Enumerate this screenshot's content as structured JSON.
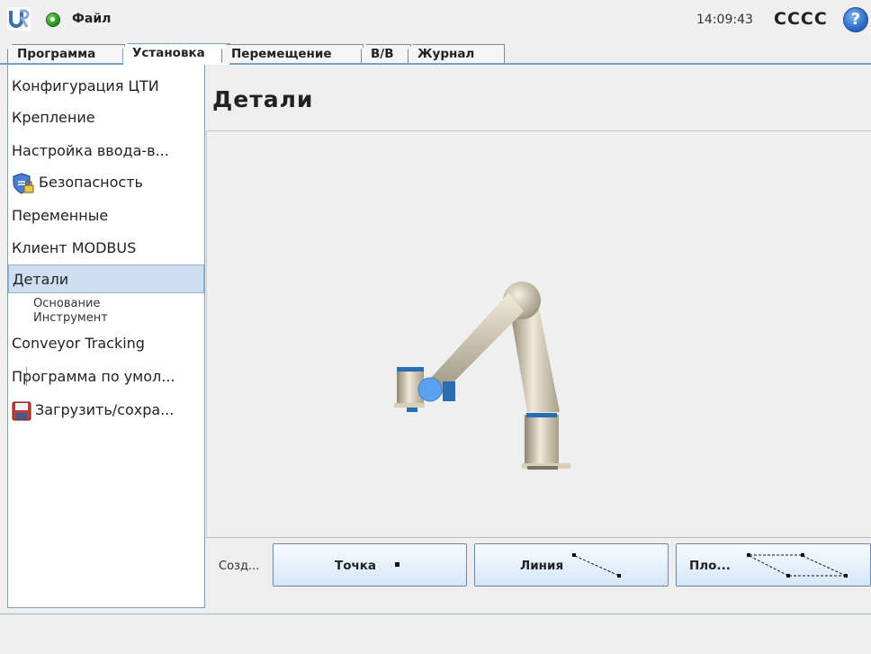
{
  "header": {
    "file_menu": "Файл",
    "time": "14:09:43",
    "robot_name": "CCCC",
    "help": "?"
  },
  "tabs": [
    {
      "label": "Программа",
      "active": false
    },
    {
      "label": "Установка",
      "active": true
    },
    {
      "label": "Перемещение",
      "active": false
    },
    {
      "label": "В/В",
      "active": false
    },
    {
      "label": "Журнал",
      "active": false
    }
  ],
  "sidebar": {
    "items": [
      {
        "label": "Конфигурация ЦТИ"
      },
      {
        "label": "Крепление"
      },
      {
        "label": "Настройка ввода-в..."
      },
      {
        "label": "Безопасность",
        "icon": "shield-lock-icon"
      },
      {
        "label": "Переменные"
      },
      {
        "label": "Клиент MODBUS"
      },
      {
        "label": "Детали",
        "active": true
      },
      {
        "label": "Conveyor Tracking"
      },
      {
        "label": "Программа по умол..."
      },
      {
        "label": "Загрузить/сохра...",
        "icon": "floppy-disk-icon"
      }
    ],
    "sub_items": [
      "Основание",
      "Инструмент"
    ]
  },
  "main": {
    "title": "Детали",
    "create_label": "Созд...",
    "buttons": [
      {
        "label": "Точка",
        "icon": "point-icon"
      },
      {
        "label": "Линия",
        "icon": "line-icon"
      },
      {
        "label": "Пло...",
        "icon": "plane-icon"
      }
    ]
  },
  "colors": {
    "accent": "#7a9fc4",
    "selection": "#cfddf0",
    "robot_body": "#d9cfb6",
    "robot_ring": "#2a6db5",
    "tcp_point": "#5aa2ef"
  }
}
